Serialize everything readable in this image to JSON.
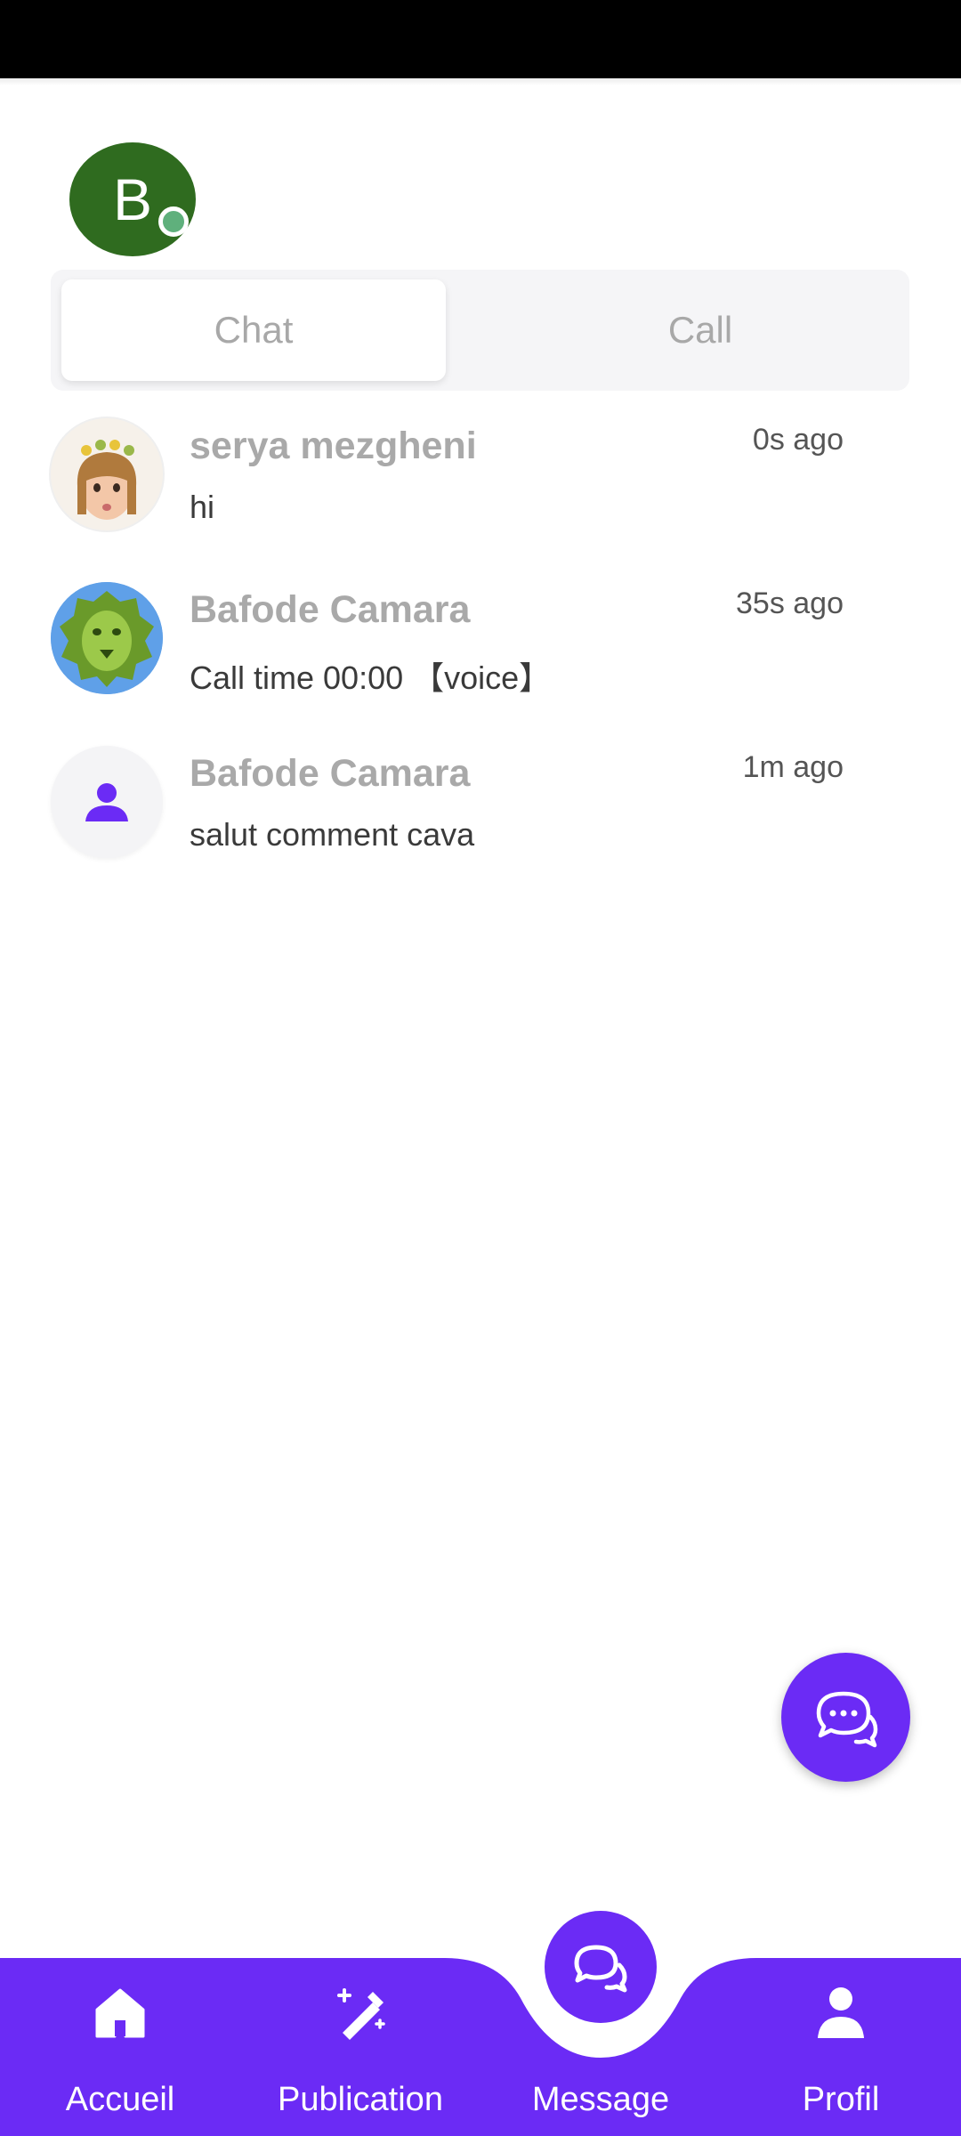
{
  "user": {
    "initial": "B",
    "online_color": "#5fb07c",
    "avatar_color": "#2f6b1f"
  },
  "tabs": [
    {
      "label": "Chat",
      "selected": true
    },
    {
      "label": "Call",
      "selected": false
    }
  ],
  "conversations": [
    {
      "name": "serya mezgheni",
      "time": "0s ago",
      "message": "hi",
      "avatar": "memoji-girl-with-flower-crown"
    },
    {
      "name": "Bafode Camara",
      "time": "35s ago",
      "message": "Call time 00:00 【voice】",
      "avatar": "green-lion"
    },
    {
      "name": "Bafode Camara",
      "time": "1m ago",
      "message": "salut comment cava",
      "avatar": "person-icon"
    }
  ],
  "fab": {
    "icon": "chat-bubbles-icon"
  },
  "bottom_nav": {
    "items": [
      {
        "label": "Accueil",
        "icon": "home-icon"
      },
      {
        "label": "Publication",
        "icon": "magic-wand-icon"
      },
      {
        "label": "Message",
        "icon": "chat-bubbles-icon",
        "active": true
      },
      {
        "label": "Profil",
        "icon": "person-icon"
      }
    ]
  },
  "colors": {
    "accent": "#6b2bf5",
    "muted_text": "#a9a9a9"
  }
}
